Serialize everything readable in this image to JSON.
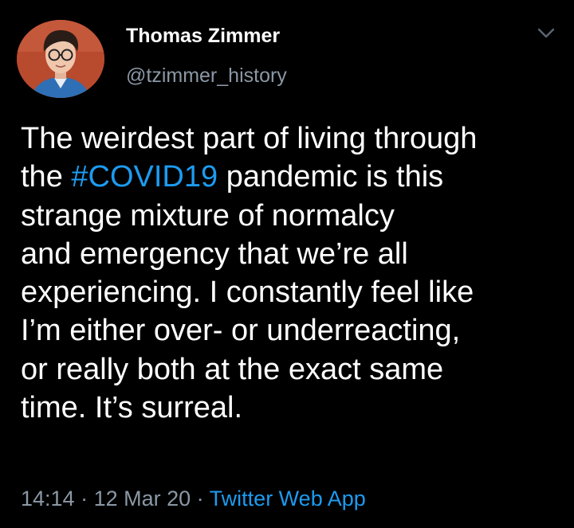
{
  "user": {
    "display_name": "Thomas Zimmer",
    "handle": "@tzimmer_history"
  },
  "tweet": {
    "lines": [
      {
        "text": "The weirdest part of living through"
      },
      {
        "pre": "the ",
        "hashtag": "#COVID19",
        "post": " pandemic is this"
      },
      {
        "text": "strange mixture of normalcy"
      },
      {
        "text": "and emergency that we’re all"
      },
      {
        "text": "experiencing. I constantly feel like"
      },
      {
        "text": "I’m either over- or underreacting,"
      },
      {
        "text": "or really both at the exact same"
      },
      {
        "text": "time. It’s surreal."
      }
    ]
  },
  "meta": {
    "time": "14:14",
    "separator": " · ",
    "date": "12 Mar 20",
    "source": "Twitter Web App"
  },
  "icons": {
    "menu": "chevron-down-icon",
    "avatar": "profile-photo"
  },
  "colors": {
    "background": "#000000",
    "text": "#ffffff",
    "secondary": "#8b98a5",
    "link": "#1d9bf0"
  }
}
